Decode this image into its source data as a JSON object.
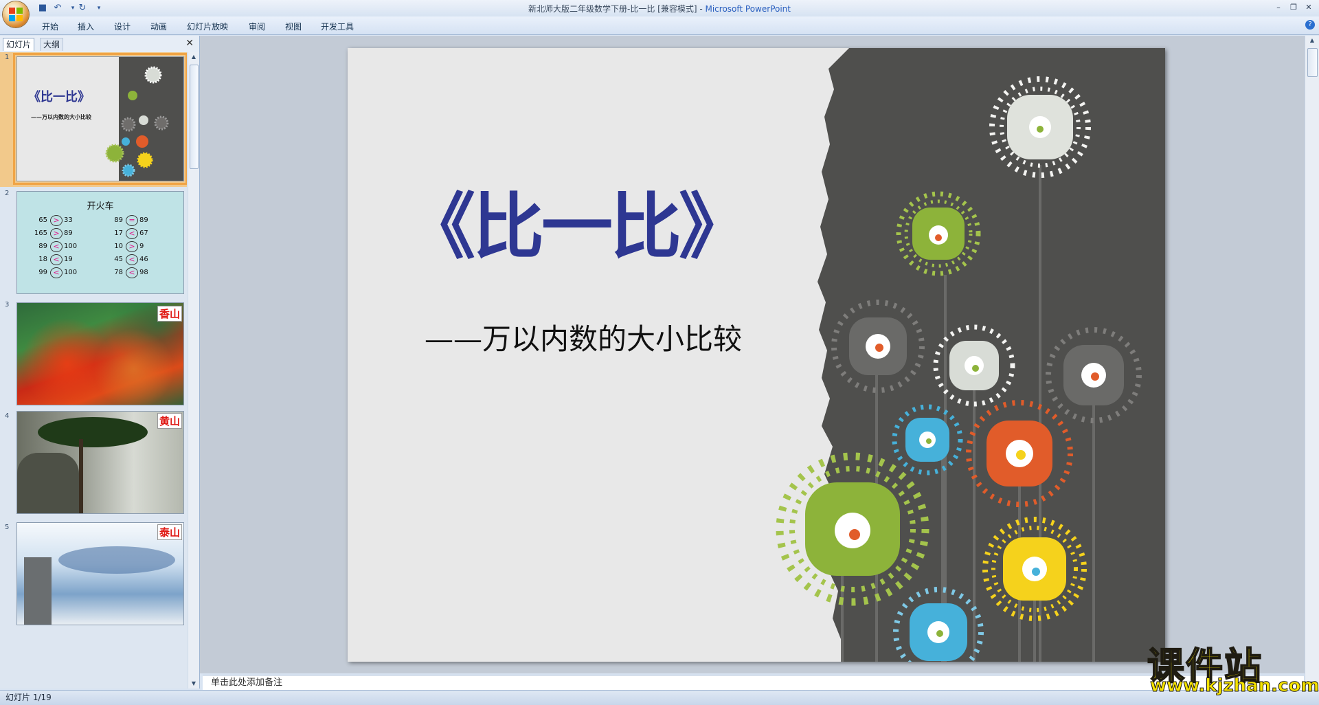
{
  "window": {
    "title": "新北师大版二年级数学下册-比一比 [兼容模式]",
    "separator": " - ",
    "app_name": "Microsoft PowerPoint",
    "min_icon": "minimize-icon",
    "max_icon": "restore-icon",
    "close_icon": "close-icon"
  },
  "ribbon": {
    "tabs": [
      "开始",
      "插入",
      "设计",
      "动画",
      "幻灯片放映",
      "审阅",
      "视图",
      "开发工具"
    ],
    "help_glyph": "?"
  },
  "left_panel": {
    "tabs": [
      "幻灯片",
      "大纲"
    ],
    "close_glyph": "✕",
    "slides": [
      {
        "number": "1",
        "title": "《比一比》",
        "subtitle": "——万以内数的大小比较"
      },
      {
        "number": "2",
        "title": "开火车",
        "rows": [
          [
            "65",
            ">",
            "33",
            "89",
            "=",
            "89"
          ],
          [
            "165",
            ">",
            "89",
            "17",
            "<",
            "67"
          ],
          [
            "89",
            "<",
            "100",
            "10",
            ">",
            "9"
          ],
          [
            "18",
            "<",
            "19",
            "45",
            "<",
            "46"
          ],
          [
            "99",
            "<",
            "100",
            "78",
            "<",
            "98"
          ]
        ]
      },
      {
        "number": "3",
        "label": "香山"
      },
      {
        "number": "4",
        "label": "黄山"
      },
      {
        "number": "5",
        "label": "泰山"
      }
    ]
  },
  "slide": {
    "title": "《比一比》",
    "subtitle": "——万以内数的大小比较",
    "title_color": "#2e3792",
    "dark_bg": "#4f4f4d"
  },
  "notes": {
    "placeholder": "单击此处添加备注"
  },
  "status": {
    "slide_counter": "幻灯片 1/19"
  },
  "watermark": {
    "title": "课件站",
    "url": "www.kjzhan.com"
  }
}
